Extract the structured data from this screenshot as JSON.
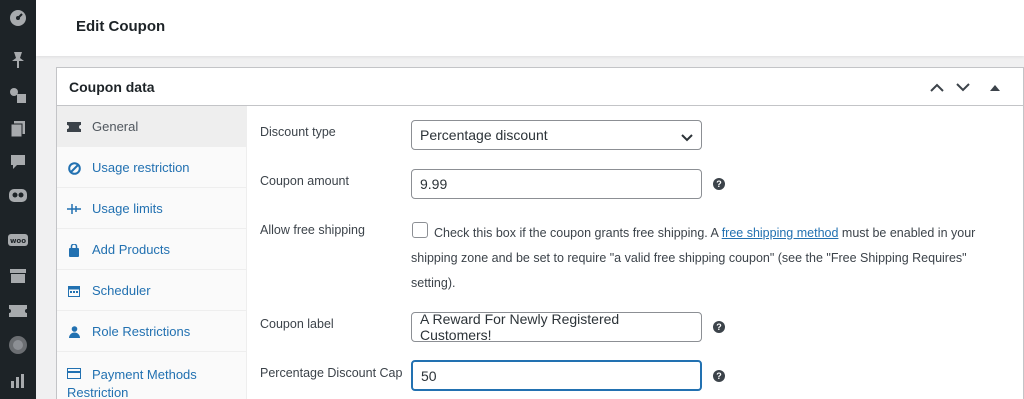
{
  "header": {
    "title": "Edit Coupon"
  },
  "adminbar": {
    "icons": [
      "dashboard-icon",
      "pin-icon",
      "media-icon",
      "pages-icon",
      "comments-icon",
      "plugin-robot-icon",
      "woo-icon",
      "products-icon",
      "coupons-icon",
      "analytics-icon",
      "stats-icon"
    ]
  },
  "panel": {
    "title": "Coupon data",
    "controls": {
      "up": "move-up",
      "down": "move-down",
      "toggle": "toggle-panel"
    }
  },
  "tabs": [
    {
      "label": "General",
      "icon": "ticket-icon",
      "active": true
    },
    {
      "label": "Usage restriction",
      "icon": "no-icon"
    },
    {
      "label": "Usage limits",
      "icon": "limits-icon"
    },
    {
      "label": "Add Products",
      "icon": "cart-icon"
    },
    {
      "label": "Scheduler",
      "icon": "calendar-icon"
    },
    {
      "label": "Role Restrictions",
      "icon": "user-icon"
    },
    {
      "label": "Payment Methods",
      "label2": "Restriction",
      "icon": "payment-icon"
    }
  ],
  "form": {
    "discount_type": {
      "label": "Discount type",
      "value": "Percentage discount"
    },
    "coupon_amount": {
      "label": "Coupon amount",
      "value": "9.99"
    },
    "free_shipping": {
      "label": "Allow free shipping",
      "text_before": "Check this box if the coupon grants free shipping. A ",
      "link": "free shipping method",
      "text_after": " must be enabled in your shipping zone and be set to require \"a valid free shipping coupon\" (see the \"Free Shipping Requires\" setting)."
    },
    "coupon_label": {
      "label": "Coupon label",
      "value": "A Reward For Newly Registered Customers!"
    },
    "percentage_cap": {
      "label": "Percentage Discount Cap",
      "value": "50"
    }
  }
}
